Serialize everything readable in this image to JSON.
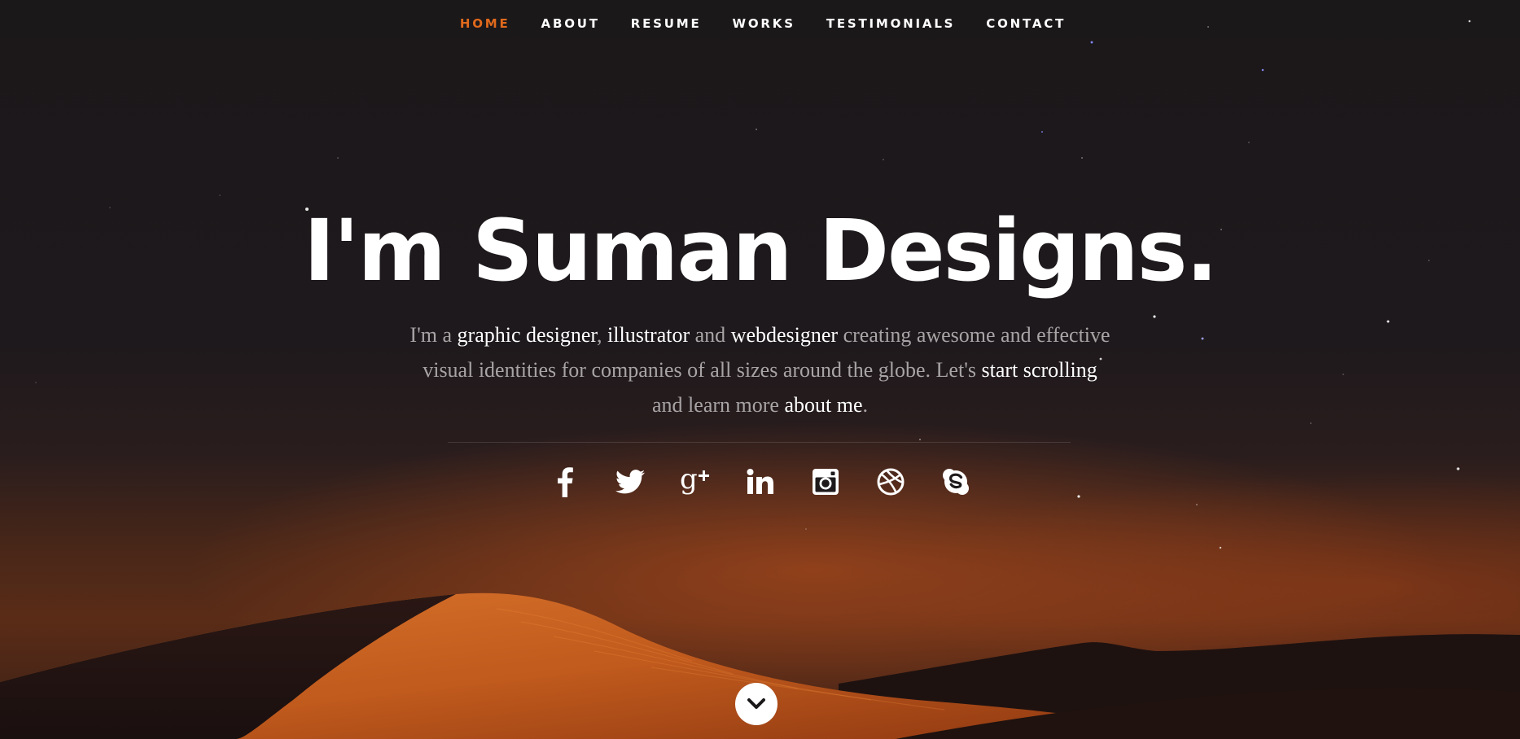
{
  "nav": {
    "items": [
      {
        "label": "HOME",
        "active": true
      },
      {
        "label": "ABOUT",
        "active": false
      },
      {
        "label": "RESUME",
        "active": false
      },
      {
        "label": "WORKS",
        "active": false
      },
      {
        "label": "TESTIMONIALS",
        "active": false
      },
      {
        "label": "CONTACT",
        "active": false
      }
    ]
  },
  "hero": {
    "headline": "I'm Suman Designs.",
    "intro": {
      "p1": "I'm a ",
      "h1": "graphic designer",
      "p2": ", ",
      "h2": "illustrator",
      "p3": " and ",
      "h3": "webdesigner",
      "p4": " creating awesome and effective visual identities for companies of all sizes around the globe. Let's ",
      "h4": "start scrolling",
      "p5": " and learn more ",
      "h5": "about me",
      "p6": "."
    }
  },
  "social": [
    {
      "icon": "facebook-icon"
    },
    {
      "icon": "twitter-icon"
    },
    {
      "icon": "google-plus-icon"
    },
    {
      "icon": "linkedin-icon"
    },
    {
      "icon": "instagram-icon"
    },
    {
      "icon": "dribbble-icon"
    },
    {
      "icon": "skype-icon"
    }
  ],
  "colors": {
    "accent": "#e0691c",
    "background": "#1b181a",
    "text": "#ffffff",
    "muted_text": "#a8a4a6"
  },
  "scroll_down": {
    "icon": "chevron-down-icon"
  }
}
